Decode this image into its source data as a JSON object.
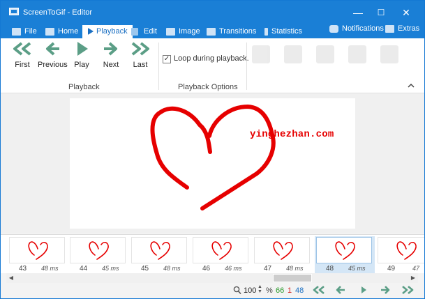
{
  "window": {
    "title": "ScreenToGif - Editor",
    "controls": {
      "minimize": "—",
      "maximize": "☐",
      "close": "✕"
    }
  },
  "tabs": [
    {
      "label": "File",
      "icon": "file-icon"
    },
    {
      "label": "Home",
      "icon": "home-icon"
    },
    {
      "label": "Playback",
      "icon": "play-icon",
      "active": true
    },
    {
      "label": "Edit",
      "icon": "edit-icon"
    },
    {
      "label": "Image",
      "icon": "image-icon"
    },
    {
      "label": "Transitions",
      "icon": "transitions-icon"
    },
    {
      "label": "Statistics",
      "icon": "info-icon"
    }
  ],
  "tabs_right": [
    {
      "label": "Notifications",
      "icon": "notification-icon"
    },
    {
      "label": "Extras",
      "icon": "extras-icon"
    }
  ],
  "ribbon": {
    "playback_buttons": [
      {
        "label": "First",
        "icon": "first-frame-icon"
      },
      {
        "label": "Previous",
        "icon": "previous-frame-icon"
      },
      {
        "label": "Play",
        "icon": "play-icon"
      },
      {
        "label": "Next",
        "icon": "next-frame-icon"
      },
      {
        "label": "Last",
        "icon": "last-frame-icon"
      }
    ],
    "playback_group_label": "Playback",
    "options_group_label": "Playback Options",
    "loop_checkbox": {
      "label": "Loop during playback.",
      "checked": true
    }
  },
  "watermark": "yinghezhan.com",
  "frames": [
    {
      "number": "43",
      "delay": "48 ms"
    },
    {
      "number": "44",
      "delay": "45 ms"
    },
    {
      "number": "45",
      "delay": "48 ms"
    },
    {
      "number": "46",
      "delay": "46 ms"
    },
    {
      "number": "47",
      "delay": "48 ms"
    },
    {
      "number": "48",
      "delay": "45 ms",
      "selected": true
    },
    {
      "number": "49",
      "delay": "47"
    }
  ],
  "status": {
    "zoom": "100",
    "zoom_unit": "%",
    "frame_count": "66",
    "selected_count": "1",
    "current_frame": "48"
  },
  "colors": {
    "accent": "#1a7fd6",
    "playback_icon": "#5b9e86",
    "heart": "#e60000",
    "selected_frame": "#d4e6f6"
  }
}
